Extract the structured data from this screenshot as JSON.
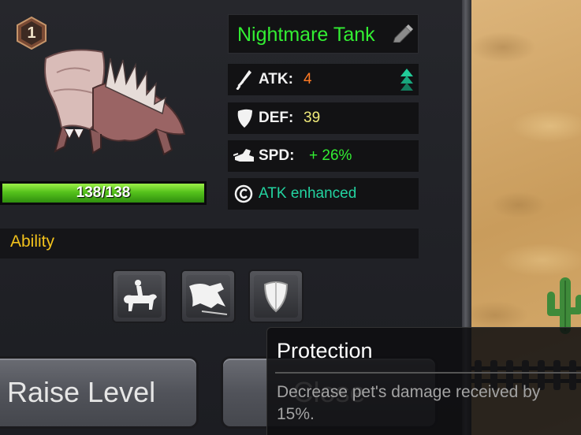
{
  "pet": {
    "level": "1",
    "name": "Nightmare Tank",
    "hp_text": "138/138",
    "hp_fraction": 1.0
  },
  "stats": {
    "atk": {
      "label": "ATK:",
      "value": "4",
      "trend_icon": "double-up-arrow-icon"
    },
    "def": {
      "label": "DEF:",
      "value": "39"
    },
    "spd": {
      "label": "SPD:",
      "value": "+ 26%"
    },
    "effect": {
      "text": "ATK enhanced"
    }
  },
  "ability": {
    "title": "Ability",
    "slots": [
      {
        "icon": "rider-horse-icon"
      },
      {
        "icon": "charging-beast-icon"
      },
      {
        "icon": "shield-icon"
      }
    ]
  },
  "buttons": {
    "raise_level": "Raise Level",
    "close": "Close"
  },
  "tooltip": {
    "title": "Protection",
    "description": "Decrease pet's damage received by 15%."
  },
  "colors": {
    "name_green": "#33ee33",
    "atk_orange": "#ff7a24",
    "def_yellow": "#f0ea7a",
    "effect_teal": "#23d3a0",
    "ability_gold": "#f2c21c",
    "hp_green": "#55c21c"
  }
}
